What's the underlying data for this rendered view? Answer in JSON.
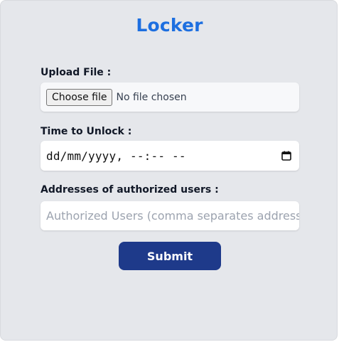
{
  "form": {
    "title": "Locker",
    "upload": {
      "label": "Upload File :",
      "button_label": "Choose file",
      "status": "No file chosen"
    },
    "unlock_time": {
      "label": "Time to Unlock :",
      "value": "dd/mm/yyyy, --:-- --",
      "icon": "calendar-icon"
    },
    "authorized_users": {
      "label": "Addresses of authorized users :",
      "placeholder": "Authorized Users (comma separates addresses)",
      "value": ""
    },
    "submit_label": "Submit"
  },
  "colors": {
    "background": "#e5e7eb",
    "title": "#1d6fe0",
    "submit_bg": "#1e3a8a",
    "submit_text": "#ffffff",
    "placeholder": "#9ca3af"
  }
}
